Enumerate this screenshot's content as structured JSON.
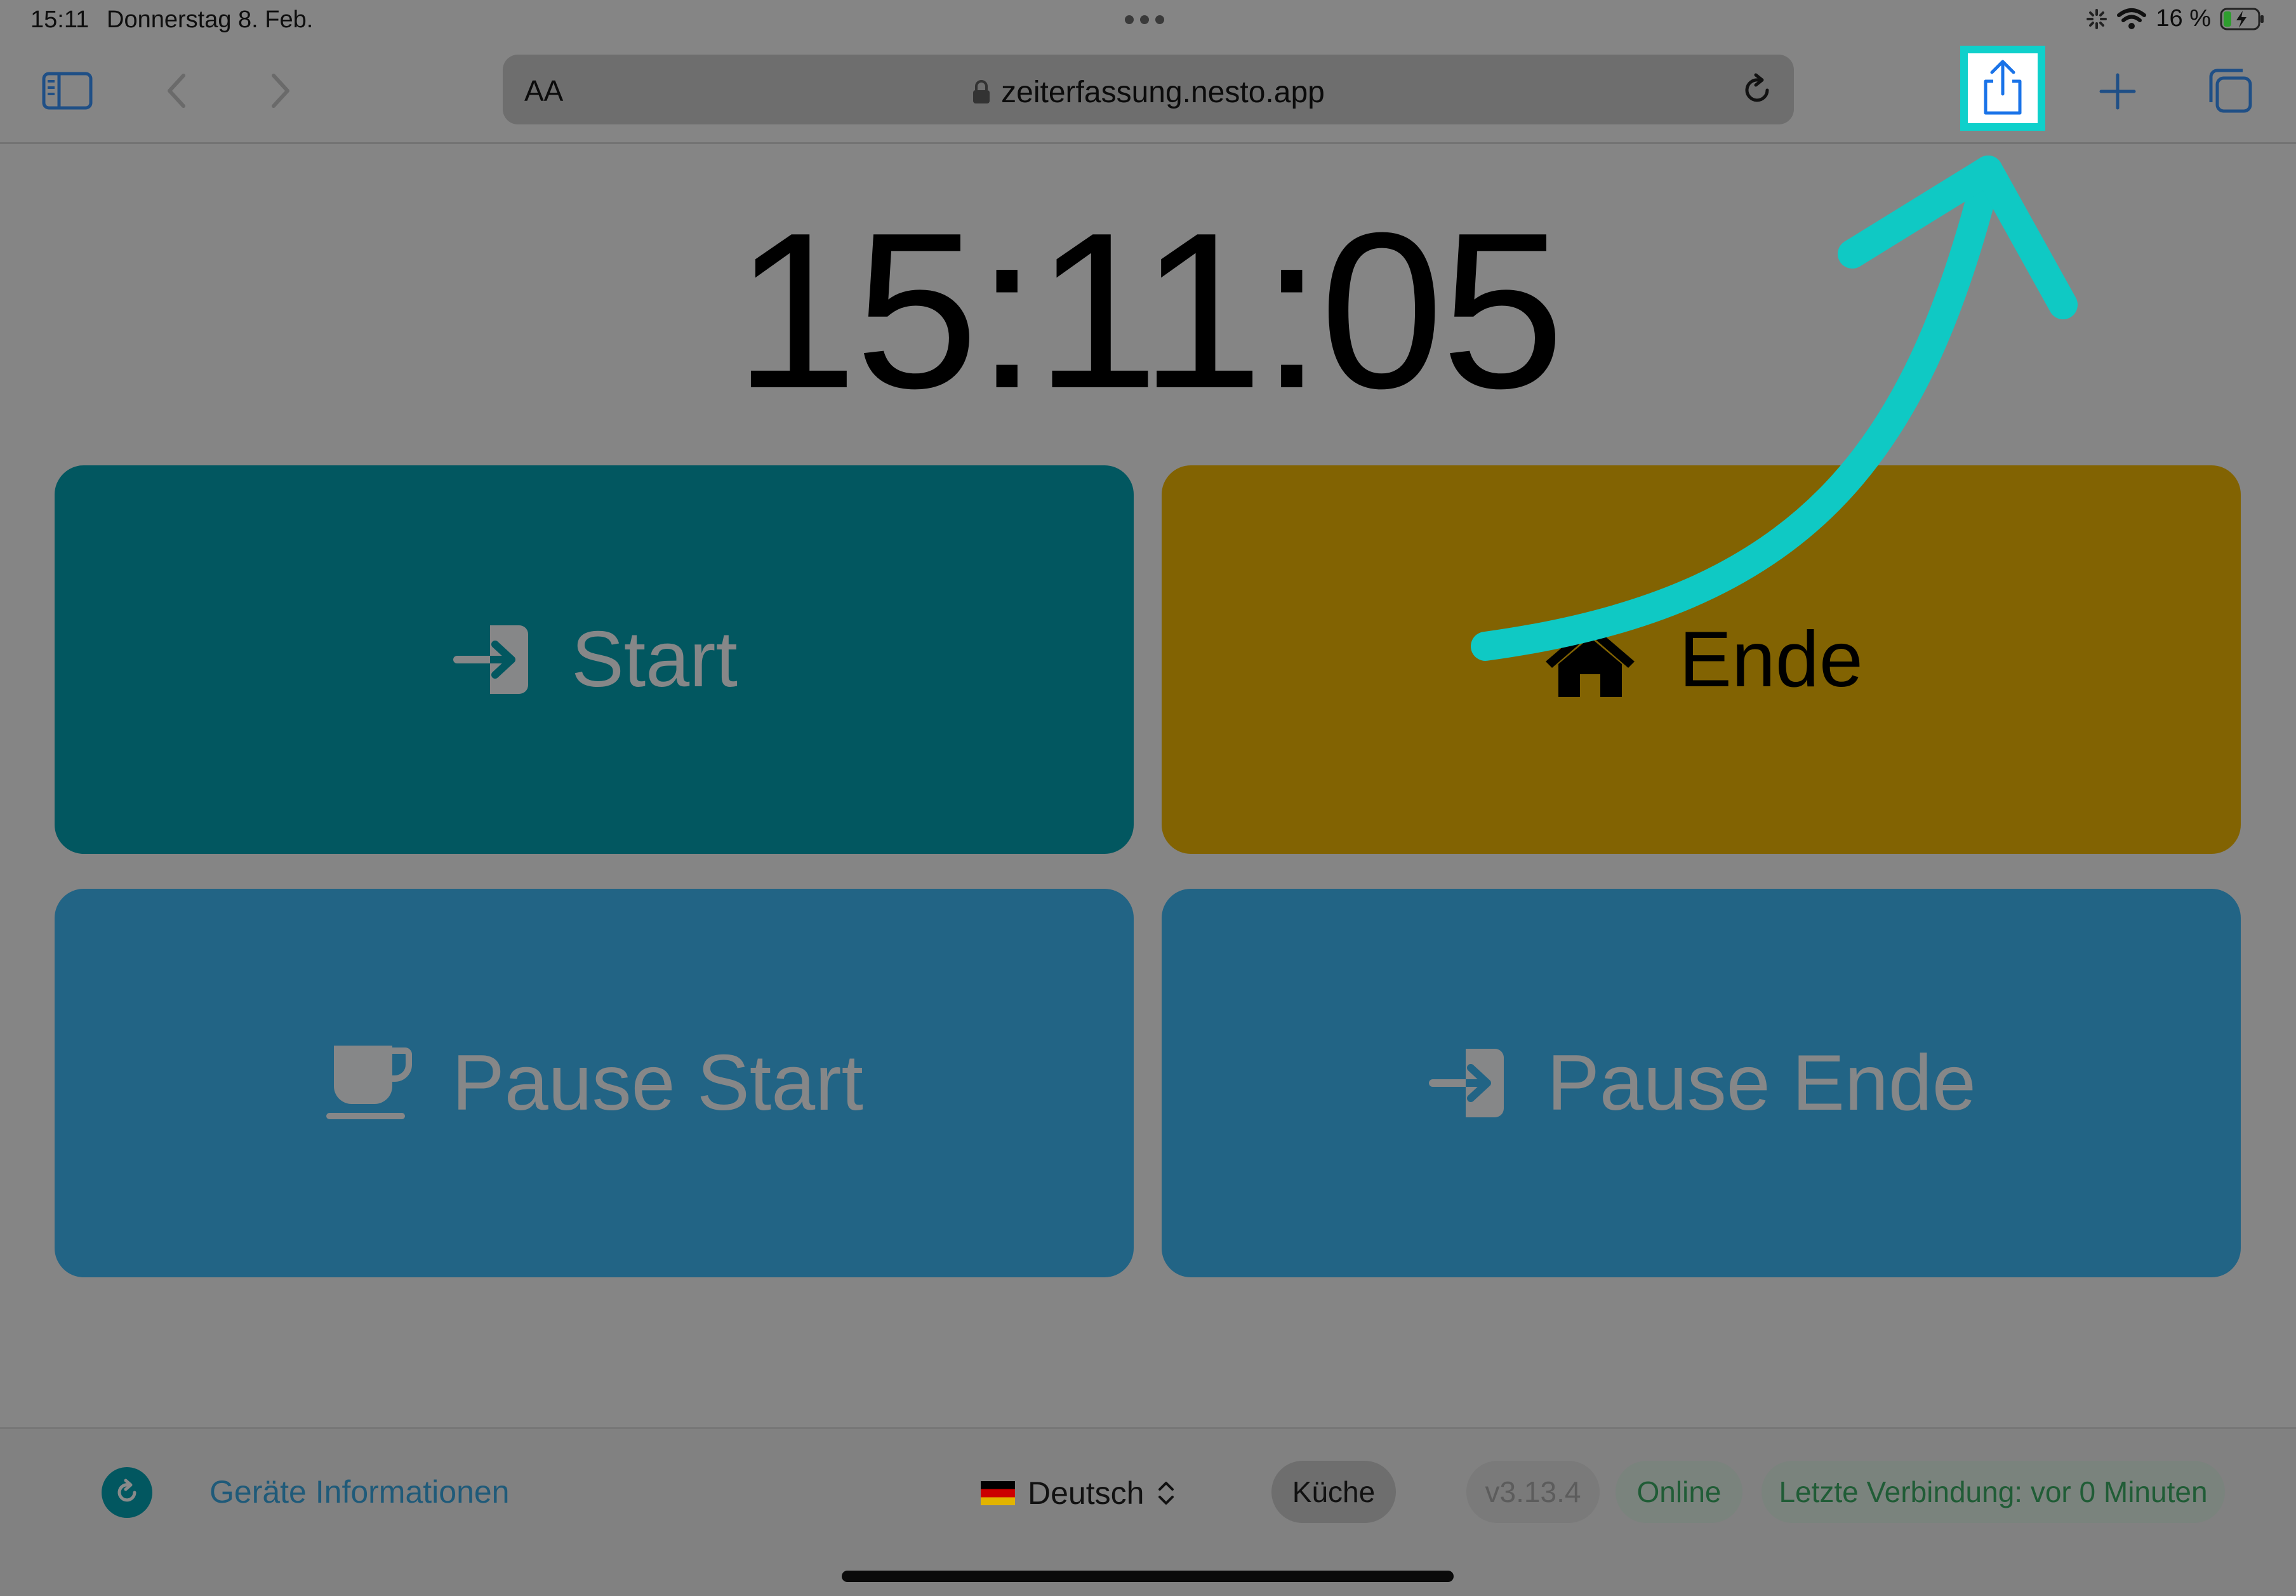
{
  "status_bar": {
    "time": "15:11",
    "date": "Donnerstag 8. Feb.",
    "battery_percent": "16 %"
  },
  "toolbar": {
    "text_size_label": "AA",
    "url": "zeiterfassung.nesto.app",
    "highlight_color": "#0fd0cb"
  },
  "clock": {
    "time": "15:11:05"
  },
  "tiles": {
    "start": {
      "label": "Start",
      "icon": "sign-in-icon",
      "color": "#025760"
    },
    "end": {
      "label": "Ende",
      "icon": "home-icon",
      "color": "#826302"
    },
    "pause_start": {
      "label": "Pause Start",
      "icon": "coffee-cup-icon",
      "color": "#226485"
    },
    "pause_end": {
      "label": "Pause Ende",
      "icon": "sign-in-icon",
      "color": "#226485"
    }
  },
  "footer": {
    "device_info_label": "Geräte Informationen",
    "language": "Deutsch",
    "room": "Küche",
    "version": "v3.13.4",
    "status": "Online",
    "last_connection": "Letzte Verbindung: vor 0 Minuten"
  },
  "overlay": {
    "arrow_color": "#0fc9c4"
  }
}
